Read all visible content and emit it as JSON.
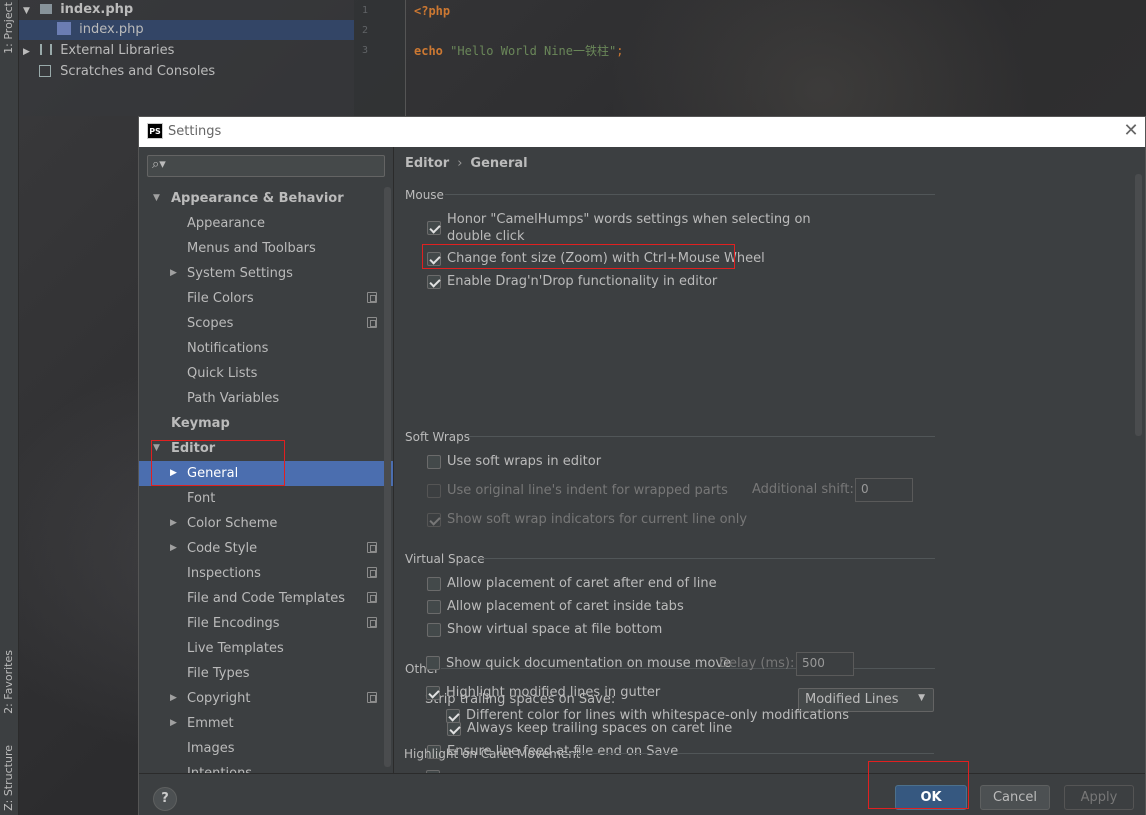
{
  "ide": {
    "left_tabs": {
      "project": "1: Project",
      "favorites": "2: Favorites",
      "structure": "Z: Structure"
    },
    "project_tree": {
      "root": "index.php",
      "file": "index.php",
      "external": "External Libraries",
      "scratches": "Scratches and Consoles"
    },
    "editor": {
      "line_numbers": [
        "1",
        "2",
        "3"
      ],
      "line1": "<?php",
      "line3_keyword": "echo",
      "line3_string": "\"Hello World Nine一铁柱\"",
      "line3_end": ";"
    }
  },
  "dialog": {
    "logo": "PS",
    "title": "Settings",
    "close": "✕"
  },
  "sidebar": {
    "search_placeholder": "",
    "items": [
      {
        "label": "Appearance & Behavior"
      },
      {
        "label": "Appearance"
      },
      {
        "label": "Menus and Toolbars"
      },
      {
        "label": "System Settings"
      },
      {
        "label": "File Colors"
      },
      {
        "label": "Scopes"
      },
      {
        "label": "Notifications"
      },
      {
        "label": "Quick Lists"
      },
      {
        "label": "Path Variables"
      },
      {
        "label": "Keymap"
      },
      {
        "label": "Editor"
      },
      {
        "label": "General"
      },
      {
        "label": "Font"
      },
      {
        "label": "Color Scheme"
      },
      {
        "label": "Code Style"
      },
      {
        "label": "Inspections"
      },
      {
        "label": "File and Code Templates"
      },
      {
        "label": "File Encodings"
      },
      {
        "label": "Live Templates"
      },
      {
        "label": "File Types"
      },
      {
        "label": "Copyright"
      },
      {
        "label": "Emmet"
      },
      {
        "label": "Images"
      },
      {
        "label": "Intentions"
      }
    ]
  },
  "content": {
    "breadcrumb": {
      "parent": "Editor",
      "separator": "›",
      "current": "General"
    },
    "mouse": {
      "title": "Mouse",
      "camelhumps_line1": "Honor \"CamelHumps\" words settings when selecting on",
      "camelhumps_line2": "double click",
      "zoom": "Change font size (Zoom) with Ctrl+Mouse Wheel",
      "dragdrop": "Enable Drag'n'Drop functionality in editor"
    },
    "soft_wraps": {
      "title": "Soft Wraps",
      "use_soft_wraps": "Use soft wraps in editor",
      "original_indent": "Use original line's indent for wrapped parts",
      "additional_shift_label": "Additional shift:",
      "additional_shift_value": "0",
      "indicators": "Show soft wrap indicators for current line only"
    },
    "virtual_space": {
      "title": "Virtual Space",
      "after_end": "Allow placement of caret after end of line",
      "inside_tabs": "Allow placement of caret inside tabs",
      "show_at_bottom": "Show virtual space at file bottom"
    },
    "other": {
      "title": "Other",
      "strip_label": "Strip trailing spaces on Save:",
      "strip_value": "Modified Lines",
      "keep_trailing": "Always keep trailing spaces on caret line",
      "line_feed": "Ensure line feed at file end on Save",
      "quick_doc": "Show quick documentation on mouse move",
      "delay_label": "Delay (ms):",
      "delay_value": "500",
      "highlight_modified": "Highlight modified lines in gutter",
      "whitespace_color": "Different color for lines with whitespace-only modifications"
    },
    "caret": {
      "title": "Highlight on Caret Movement"
    }
  },
  "footer": {
    "help": "?",
    "ok": "OK",
    "cancel": "Cancel",
    "apply": "Apply"
  },
  "colors": {
    "selection": "#4b6eaf",
    "primary_button": "#365880",
    "annotation_box": "#e02020"
  }
}
